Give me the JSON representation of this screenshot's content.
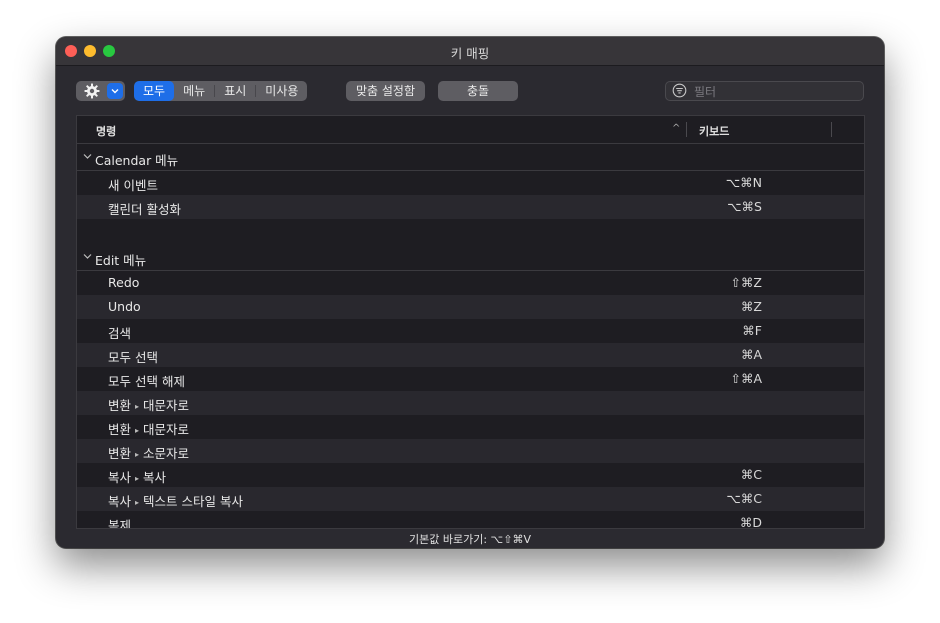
{
  "window": {
    "title": "키 매핑"
  },
  "toolbar": {
    "filter_tabs": [
      "모두",
      "메뉴",
      "표시",
      "미사용"
    ],
    "active_tab": "모두",
    "custom_button": "맞춤 설정함",
    "conflict_button": "충돌",
    "search_placeholder": "필터"
  },
  "table": {
    "headers": {
      "command": "명령",
      "shortcut": "키보드"
    },
    "groups": [
      {
        "name": "Calendar 메뉴",
        "items": [
          {
            "name": "새 이벤트",
            "shortcut": "⌥⌘N"
          },
          {
            "name": "캘린더 활성화",
            "shortcut": "⌥⌘S"
          }
        ]
      },
      {
        "name": "Edit 메뉴",
        "items": [
          {
            "name": "Redo",
            "shortcut": "⇧⌘Z"
          },
          {
            "name": "Undo",
            "shortcut": "⌘Z"
          },
          {
            "name": "검색",
            "shortcut": "⌘F"
          },
          {
            "name": "모두 선택",
            "shortcut": "⌘A"
          },
          {
            "name": "모두 선택 해제",
            "shortcut": "⇧⌘A"
          },
          {
            "name": [
              "변환",
              "대문자로"
            ],
            "shortcut": ""
          },
          {
            "name": [
              "변환",
              "대문자로"
            ],
            "shortcut": ""
          },
          {
            "name": [
              "변환",
              "소문자로"
            ],
            "shortcut": ""
          },
          {
            "name": [
              "복사",
              "복사"
            ],
            "shortcut": "⌘C"
          },
          {
            "name": [
              "복사",
              "텍스트 스타일 복사"
            ],
            "shortcut": "⌥⌘C"
          },
          {
            "name": "복제",
            "shortcut": "⌘D"
          }
        ]
      }
    ]
  },
  "footer": {
    "text": "기본값 바로가기: ⌥⇧⌘V"
  },
  "colors": {
    "accent": "#1e6ee8",
    "window_bg": "#2b2a30",
    "table_bg": "#1e1d22",
    "row_alt": "#29282e"
  }
}
